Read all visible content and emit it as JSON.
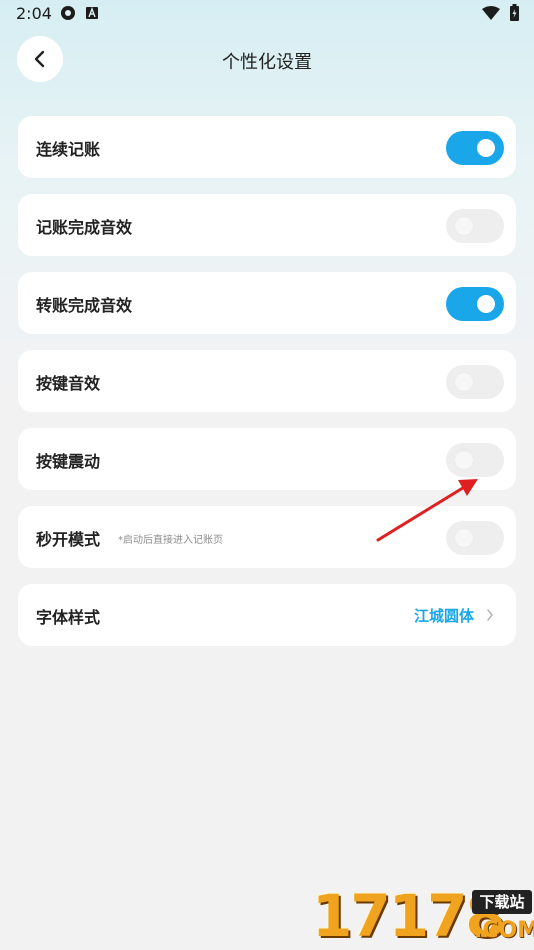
{
  "status_bar": {
    "time": "2:04",
    "icons": [
      "settings-cog-icon",
      "a-badge-icon",
      "wifi-icon",
      "battery-icon"
    ]
  },
  "header": {
    "title": "个性化设置",
    "back_icon": "chevron-left-icon"
  },
  "settings": [
    {
      "label": "连续记账",
      "type": "toggle",
      "on": true
    },
    {
      "label": "记账完成音效",
      "type": "toggle",
      "on": false
    },
    {
      "label": "转账完成音效",
      "type": "toggle",
      "on": true
    },
    {
      "label": "按键音效",
      "type": "toggle",
      "on": false
    },
    {
      "label": "按键震动",
      "type": "toggle",
      "on": false
    },
    {
      "label": "秒开模式",
      "hint": "*启动后直接进入记账页",
      "type": "toggle",
      "on": false
    },
    {
      "label": "字体样式",
      "type": "link",
      "value": "江城圆体"
    }
  ],
  "colors": {
    "accent": "#1aa7e9",
    "toggle_off": "#eeeeee",
    "card": "#ffffff",
    "annotation_arrow": "#e02020"
  },
  "watermark": {
    "digits": "17178",
    "badge": "下载站",
    "suffix": ".COM"
  }
}
